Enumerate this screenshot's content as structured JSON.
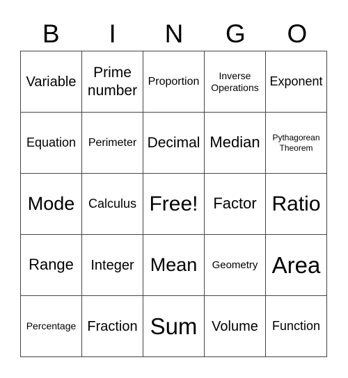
{
  "header": [
    "B",
    "I",
    "N",
    "G",
    "O"
  ],
  "rows": [
    [
      "Variable",
      "Prime number",
      "Proportion",
      "Inverse Operations",
      "Exponent"
    ],
    [
      "Equation",
      "Perimeter",
      "Decimal",
      "Median",
      "Pythagorean Theorem"
    ],
    [
      "Mode",
      "Calculus",
      "Free!",
      "Factor",
      "Ratio"
    ],
    [
      "Range",
      "Integer",
      "Mean",
      "Geometry",
      "Area"
    ],
    [
      "Percentage",
      "Fraction",
      "Sum",
      "Volume",
      "Function"
    ]
  ]
}
